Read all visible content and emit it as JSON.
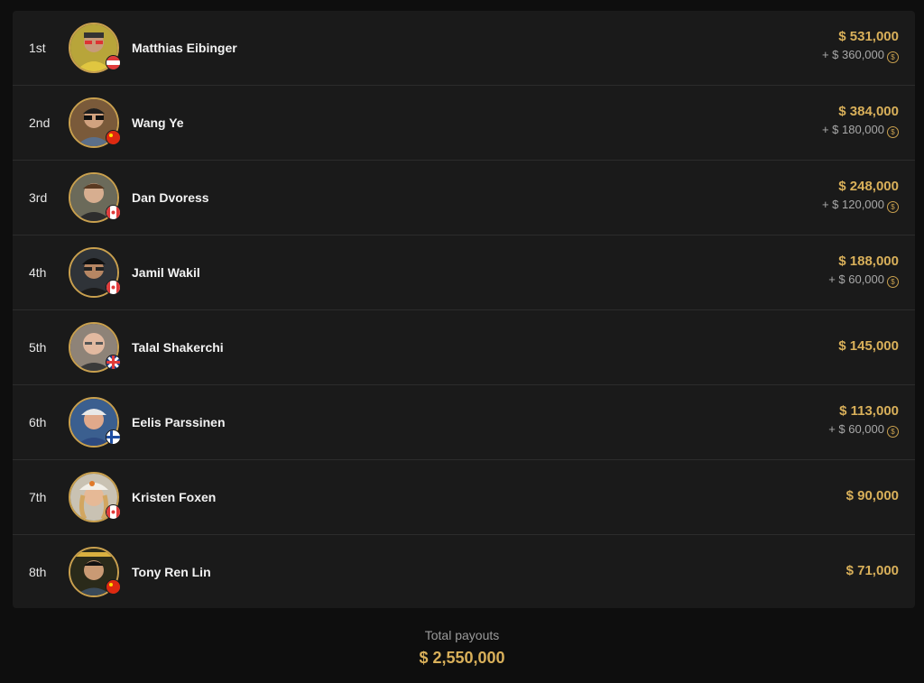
{
  "colors": {
    "accent": "#d9b05a",
    "background": "#0e0e0e",
    "panel": "#1a1a1a"
  },
  "bonus_icon_name": "gold-coin-icon",
  "payouts": [
    {
      "rank": "1st",
      "name": "Matthias Eibinger",
      "amount": "$ 531,000",
      "bonus": "+ $ 360,000",
      "flag": "austria-flag-icon"
    },
    {
      "rank": "2nd",
      "name": "Wang Ye",
      "amount": "$ 384,000",
      "bonus": "+ $ 180,000",
      "flag": "china-flag-icon"
    },
    {
      "rank": "3rd",
      "name": "Dan Dvoress",
      "amount": "$ 248,000",
      "bonus": "+ $ 120,000",
      "flag": "canada-flag-icon"
    },
    {
      "rank": "4th",
      "name": "Jamil Wakil",
      "amount": "$ 188,000",
      "bonus": "+ $ 60,000",
      "flag": "canada-flag-icon"
    },
    {
      "rank": "5th",
      "name": "Talal Shakerchi",
      "amount": "$ 145,000",
      "bonus": "",
      "flag": "uk-flag-icon"
    },
    {
      "rank": "6th",
      "name": "Eelis Parssinen",
      "amount": "$ 113,000",
      "bonus": "+ $ 60,000",
      "flag": "finland-flag-icon"
    },
    {
      "rank": "7th",
      "name": "Kristen Foxen",
      "amount": "$ 90,000",
      "bonus": "",
      "flag": "canada-flag-icon"
    },
    {
      "rank": "8th",
      "name": "Tony Ren Lin",
      "amount": "$ 71,000",
      "bonus": "",
      "flag": "china-flag-icon"
    }
  ],
  "total": {
    "label": "Total payouts",
    "value": "$ 2,550,000"
  }
}
